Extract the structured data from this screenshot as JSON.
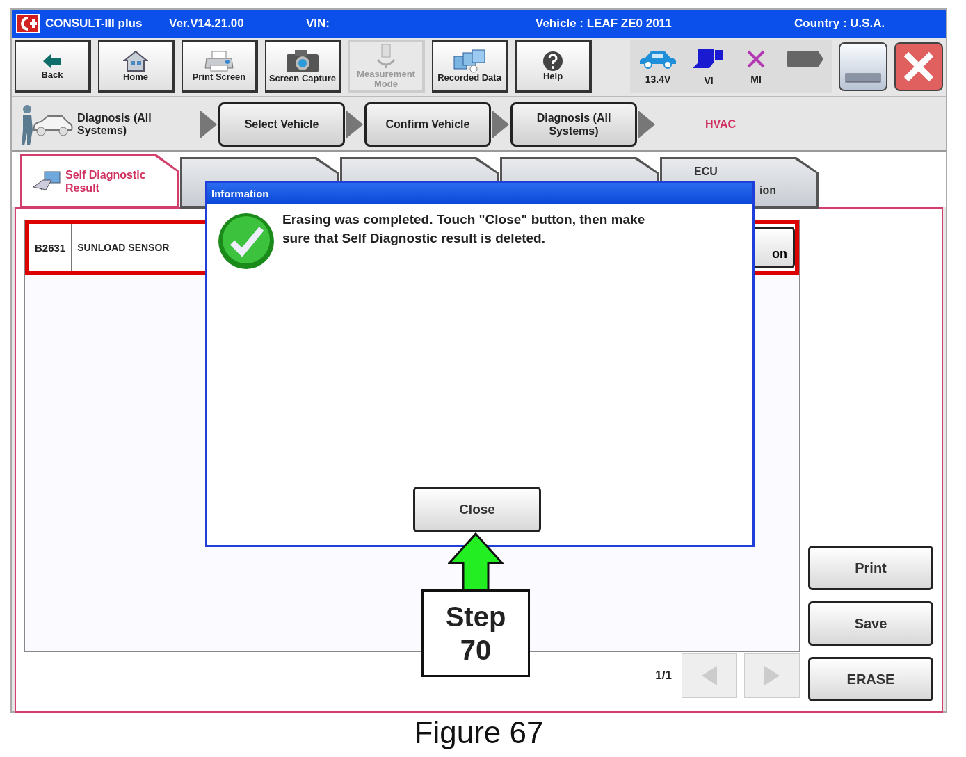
{
  "window": {
    "app_name": "CONSULT-III plus",
    "version": "Ver.V14.21.00",
    "vin_label": "VIN:",
    "vehicle": "Vehicle : LEAF ZE0 2011",
    "country": "Country : U.S.A."
  },
  "toolbar": [
    {
      "label": "Back",
      "disabled": false
    },
    {
      "label": "Home",
      "disabled": false
    },
    {
      "label": "Print Screen",
      "disabled": false
    },
    {
      "label": "Screen Capture",
      "disabled": false
    },
    {
      "label": "Measurement Mode",
      "disabled": true
    },
    {
      "label": "Recorded Data",
      "disabled": false
    },
    {
      "label": "Help",
      "disabled": false
    }
  ],
  "status": [
    {
      "kind": "car",
      "label": "13.4V"
    },
    {
      "kind": "vi",
      "label": "VI"
    },
    {
      "kind": "mi",
      "label": "MI"
    },
    {
      "kind": "tag"
    }
  ],
  "breadcrumb": {
    "current": "Diagnosis (All Systems)",
    "steps": [
      "Select Vehicle",
      "Confirm Vehicle",
      "Diagnosis (All Systems)"
    ],
    "system": "HVAC"
  },
  "tabs": [
    {
      "lines": [
        "Self Diagnostic",
        "Result"
      ],
      "selected": true
    },
    {
      "selected": false
    },
    {
      "selected": false
    },
    {
      "selected": false
    },
    {
      "lines": [
        "ECU",
        "ion"
      ],
      "selected": false
    }
  ],
  "results": [
    {
      "code": "B2631",
      "name": "SUNLOAD SENSOR",
      "button": "on"
    }
  ],
  "pager": {
    "page": "1/1",
    "prev_disabled": true,
    "next_disabled": true
  },
  "side_buttons": [
    "Print",
    "Save",
    "ERASE"
  ],
  "dialog": {
    "title": "Information",
    "message": "Erasing was completed. Touch \"Close\" button, then make sure that Self Diagnostic result is deleted.",
    "button": "Close"
  },
  "callout": {
    "text": "Step 70"
  },
  "caption": "Figure 67"
}
